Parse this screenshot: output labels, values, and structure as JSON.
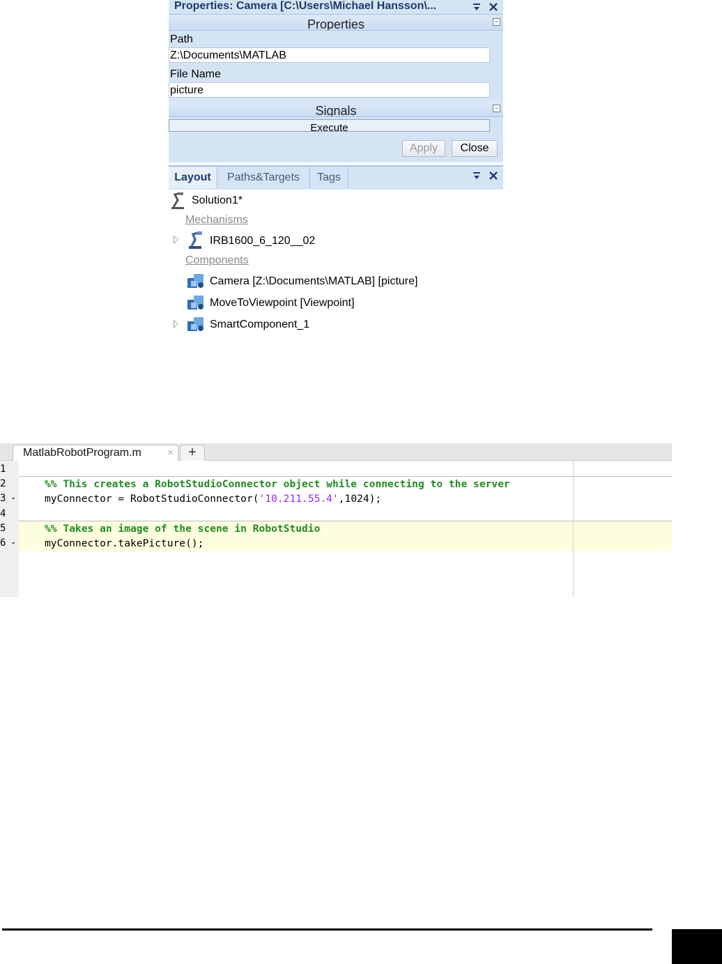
{
  "properties_panel": {
    "title": "Properties:  Camera  [C:\\Users\\Michael  Hansson\\...",
    "section_properties": "Properties",
    "path_label": "Path",
    "path_value": "Z:\\Documents\\MATLAB",
    "filename_label": "File Name",
    "filename_value": "picture",
    "section_signals": "Signals",
    "execute_label": "Execute",
    "apply_label": "Apply",
    "close_label": "Close"
  },
  "layout_panel": {
    "tabs": [
      "Layout",
      "Paths&Targets",
      "Tags"
    ],
    "solution": "Solution1*",
    "mechanisms_header": "Mechanisms",
    "mechanism": "IRB1600_6_120__02",
    "components_header": "Components",
    "components": [
      "Camera [Z:\\Documents\\MATLAB] [picture]",
      "MoveToViewpoint [Viewpoint]",
      "SmartComponent_1"
    ]
  },
  "editor": {
    "tab_label": "MatlabRobotProgram.m",
    "tab_close": "×",
    "new_tab": "+",
    "line_numbers": [
      "1",
      "2",
      "3",
      "4",
      "5",
      "6"
    ],
    "line_marks": [
      "",
      "",
      "-",
      "",
      "",
      "-"
    ],
    "line2_comment": "%% This creates a RobotStudioConnector object while connecting to the server",
    "line3_before": "myConnector = RobotStudioConnector(",
    "line3_string": "'10.211.55.4'",
    "line3_after": ",1024);",
    "line5_comment": "%% Takes an image of the scene in RobotStudio",
    "line6_code": "myConnector.takePicture();"
  },
  "colors": {
    "panel_bg": "#d5e4f5",
    "title_text": "#1e3a6e",
    "comment": "#228b22",
    "string": "#a020f0",
    "cell_highlight": "#fdfde0"
  },
  "icons": [
    "dropdown-icon",
    "close-icon",
    "collapse-icon",
    "solution-icon",
    "robot-icon",
    "smart-component-icon",
    "expand-arrow-icon"
  ]
}
